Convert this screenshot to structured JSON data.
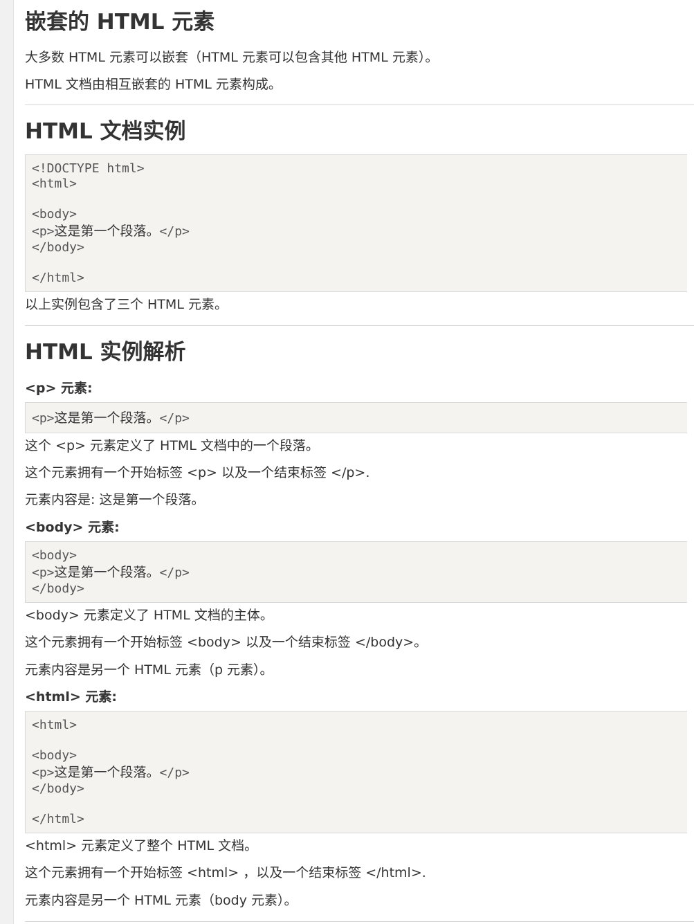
{
  "sections": {
    "nested": {
      "title": "嵌套的 HTML 元素",
      "p1": "大多数 HTML 元素可以嵌套（HTML 元素可以包含其他 HTML 元素）。",
      "p2": "HTML 文档由相互嵌套的 HTML 元素构成。"
    },
    "doc_example": {
      "title": "HTML 文档实例",
      "code": {
        "l1": "<!DOCTYPE html>",
        "l2": "<html>",
        "l3": "<body>",
        "l4_open": "<p>",
        "l4_text": "这是第一个段落。",
        "l4_close": "</p>",
        "l5": "</body>",
        "l6": "</html>"
      },
      "after": "以上实例包含了三个 HTML 元素。"
    },
    "analysis": {
      "title": "HTML 实例解析",
      "p_elem": {
        "heading": "<p> 元素:",
        "code": {
          "open": "<p>",
          "text": "这是第一个段落。",
          "close": "</p>"
        },
        "d1": "这个 <p> 元素定义了 HTML 文档中的一个段落。",
        "d2": "这个元素拥有一个开始标签 <p> 以及一个结束标签 </p>.",
        "d3": "元素内容是: 这是第一个段落。"
      },
      "body_elem": {
        "heading": "<body> 元素:",
        "code": {
          "l1": "<body>",
          "l2_open": "<p>",
          "l2_text": "这是第一个段落。",
          "l2_close": "</p>",
          "l3": "</body>"
        },
        "d1": "<body> 元素定义了 HTML 文档的主体。",
        "d2": "这个元素拥有一个开始标签 <body> 以及一个结束标签 </body>。",
        "d3": "元素内容是另一个 HTML 元素（p 元素）。"
      },
      "html_elem": {
        "heading": "<html> 元素:",
        "code": {
          "l1": "<html>",
          "l2": "<body>",
          "l3_open": "<p>",
          "l3_text": "这是第一个段落。",
          "l3_close": "</p>",
          "l4": "</body>",
          "l5": "</html>"
        },
        "d1": "<html> 元素定义了整个 HTML 文档。",
        "d2": "这个元素拥有一个开始标签 <html> ，以及一个结束标签 </html>.",
        "d3": "元素内容是另一个 HTML 元素（body 元素）。"
      }
    }
  }
}
